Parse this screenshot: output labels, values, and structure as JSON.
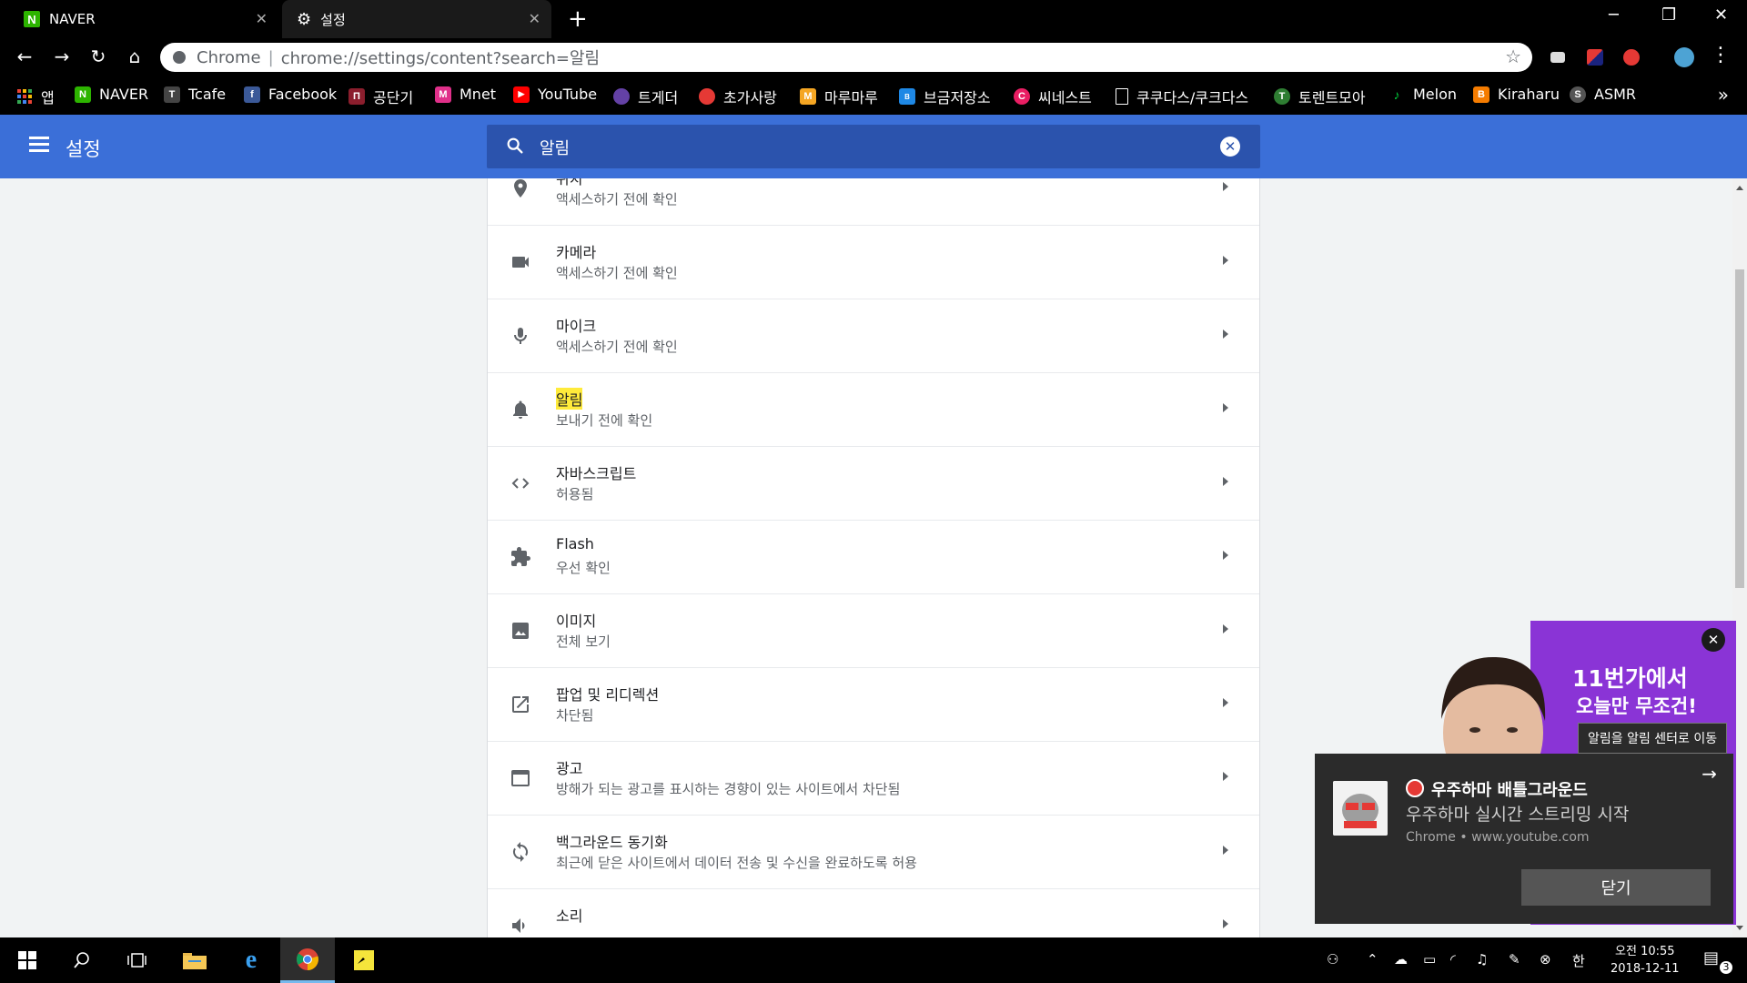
{
  "browser": {
    "tabs": [
      {
        "title": "NAVER"
      },
      {
        "title": "설정"
      }
    ],
    "omnibox": {
      "scheme": "Chrome",
      "separator": "|",
      "url": "chrome://settings/content?search=알림"
    }
  },
  "bookmarks": [
    {
      "label": "앱",
      "color": "#ea4335",
      "icon": "apps-grid-icon"
    },
    {
      "label": "NAVER",
      "color": "#2db400",
      "glyph": "N"
    },
    {
      "label": "Tcafe",
      "color": "#444444",
      "glyph": "T"
    },
    {
      "label": "Facebook",
      "color": "#3b5998",
      "glyph": "f"
    },
    {
      "label": "공단기",
      "color": "#8b1e2d",
      "glyph": "П"
    },
    {
      "label": "Mnet",
      "color": "#e0308a",
      "glyph": "M"
    },
    {
      "label": "YouTube",
      "color": "#ff0000",
      "glyph": "▶"
    },
    {
      "label": "트게더",
      "color": "#6441a5",
      "glyph": "●"
    },
    {
      "label": "초가사랑",
      "color": "#e53935",
      "glyph": "●"
    },
    {
      "label": "마루마루",
      "color": "#f5a623",
      "glyph": "M"
    },
    {
      "label": "브금저장소",
      "color": "#1e88e5",
      "glyph": "B"
    },
    {
      "label": "씨네스트",
      "color": "#e91e63",
      "glyph": "C"
    },
    {
      "label": "쿠쿠다스/쿠크다스",
      "color": "#000000",
      "glyph": "▯"
    },
    {
      "label": "토렌트모아",
      "color": "#2e7d32",
      "glyph": "T"
    },
    {
      "label": "Melon",
      "color": "#00cd3c",
      "glyph": "♪"
    },
    {
      "label": "Kiraharu",
      "color": "#f57c00",
      "glyph": "B"
    },
    {
      "label": "ASMR",
      "color": "#555555",
      "glyph": "S"
    }
  ],
  "bookmarks_more": "»",
  "settings": {
    "title": "설정",
    "search_query": "알림",
    "rows": [
      {
        "title": "위치",
        "subtitle": "액세스하기 전에 확인",
        "icon": "location-pin-icon"
      },
      {
        "title": "카메라",
        "subtitle": "액세스하기 전에 확인",
        "icon": "camera-icon"
      },
      {
        "title": "마이크",
        "subtitle": "액세스하기 전에 확인",
        "icon": "microphone-icon"
      },
      {
        "title": "알림",
        "subtitle": "보내기 전에 확인",
        "icon": "bell-icon",
        "highlight": true
      },
      {
        "title": "자바스크립트",
        "subtitle": "허용됨",
        "icon": "code-icon"
      },
      {
        "title": "Flash",
        "subtitle": "우선 확인",
        "icon": "puzzle-icon"
      },
      {
        "title": "이미지",
        "subtitle": "전체 보기",
        "icon": "image-icon"
      },
      {
        "title": "팝업 및 리디렉션",
        "subtitle": "차단됨",
        "icon": "open-in-new-icon"
      },
      {
        "title": "광고",
        "subtitle": "방해가 되는 광고를 표시하는 경향이 있는 사이트에서 차단됨",
        "icon": "ad-window-icon"
      },
      {
        "title": "백그라운드 동기화",
        "subtitle": "최근에 닫은 사이트에서 데이터 전송 및 수신을 완료하도록 허용",
        "icon": "sync-icon"
      },
      {
        "title": "소리",
        "subtitle": "",
        "icon": "speaker-icon"
      }
    ]
  },
  "ad": {
    "line1": "11번가에서",
    "line2": "오늘만 무조건!"
  },
  "notification": {
    "tooltip": "알림을 알림 센터로 이동",
    "title": "우주하마 배틀그라운드",
    "body": "우주하마 실시간 스트리밍 시작",
    "source": "Chrome • www.youtube.com",
    "close_label": "닫기"
  },
  "taskbar": {
    "ime": "한",
    "time": "오전 10:55",
    "date": "2018-12-11",
    "notification_count": "3"
  },
  "colors": {
    "accent": "#3b6fd8",
    "search_bg": "#2b53ad",
    "highlight": "#ffeb3b"
  }
}
